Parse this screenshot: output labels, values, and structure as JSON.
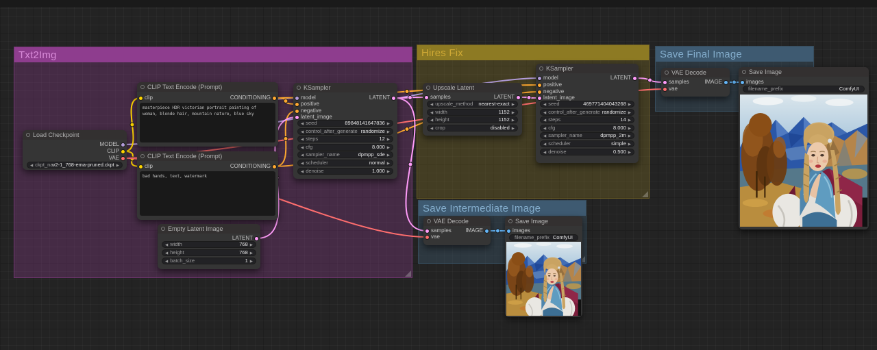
{
  "colors": {
    "MODEL": "#B39DDB",
    "CLIP": "#FFD500",
    "VAE": "#FF6E6E",
    "CONDITIONING": "#FFA931",
    "LATENT": "#FF9CF9",
    "IMAGE": "#64B5F6"
  },
  "groups": {
    "txt2img": {
      "title": "Txt2Img",
      "color": "#8e3d8e"
    },
    "hires_fix": {
      "title": "Hires Fix",
      "color": "#8d7a23"
    },
    "save_intermediate": {
      "title": "Save Intermediate Image",
      "color": "#3e5a71"
    },
    "save_final": {
      "title": "Save Final Image",
      "color": "#3e5a71"
    }
  },
  "nodes": {
    "load_checkpoint": {
      "title": "Load Checkpoint",
      "outputs": [
        "MODEL",
        "CLIP",
        "VAE"
      ],
      "widgets": [
        {
          "name": "ckpt_name",
          "value": "v2-1_768-ema-pruned.ckpt"
        }
      ]
    },
    "clip_positive": {
      "title": "CLIP Text Encode (Prompt)",
      "inputs": [
        "clip"
      ],
      "output": "CONDITIONING",
      "text": "masterpiece HDR victorian portrait painting of woman, blonde hair, mountain nature, blue sky"
    },
    "clip_negative": {
      "title": "CLIP Text Encode (Prompt)",
      "inputs": [
        "clip"
      ],
      "output": "CONDITIONING",
      "text": "bad hands, text, watermark"
    },
    "empty_latent": {
      "title": "Empty Latent Image",
      "output": "LATENT",
      "widgets": [
        {
          "name": "width",
          "value": "768"
        },
        {
          "name": "height",
          "value": "768"
        },
        {
          "name": "batch_size",
          "value": "1"
        }
      ]
    },
    "ksampler1": {
      "title": "KSampler",
      "inputs": [
        "model",
        "positive",
        "negative",
        "latent_image"
      ],
      "output": "LATENT",
      "widgets": [
        {
          "name": "seed",
          "value": "89848141647836"
        },
        {
          "name": "control_after_generate",
          "value": "randomize"
        },
        {
          "name": "steps",
          "value": "12"
        },
        {
          "name": "cfg",
          "value": "8.000"
        },
        {
          "name": "sampler_name",
          "value": "dpmpp_sde"
        },
        {
          "name": "scheduler",
          "value": "normal"
        },
        {
          "name": "denoise",
          "value": "1.000"
        }
      ]
    },
    "upscale_latent": {
      "title": "Upscale Latent",
      "inputs": [
        "samples"
      ],
      "output": "LATENT",
      "widgets": [
        {
          "name": "upscale_method",
          "value": "nearest-exact"
        },
        {
          "name": "width",
          "value": "1152"
        },
        {
          "name": "height",
          "value": "1152"
        },
        {
          "name": "crop",
          "value": "disabled"
        }
      ]
    },
    "ksampler2": {
      "title": "KSampler",
      "inputs": [
        "model",
        "positive",
        "negative",
        "latent_image"
      ],
      "output": "LATENT",
      "widgets": [
        {
          "name": "seed",
          "value": "469771404043268"
        },
        {
          "name": "control_after_generate",
          "value": "randomize"
        },
        {
          "name": "steps",
          "value": "14"
        },
        {
          "name": "cfg",
          "value": "8.000"
        },
        {
          "name": "sampler_name",
          "value": "dpmpp_2m"
        },
        {
          "name": "scheduler",
          "value": "simple"
        },
        {
          "name": "denoise",
          "value": "0.500"
        }
      ]
    },
    "vae_decode1": {
      "title": "VAE Decode",
      "inputs": [
        "samples",
        "vae"
      ],
      "output": "IMAGE"
    },
    "save_image1": {
      "title": "Save Image",
      "inputs": [
        "images"
      ],
      "widgets": [
        {
          "name": "filename_prefix",
          "value": "ComfyUI"
        }
      ]
    },
    "vae_decode2": {
      "title": "VAE Decode",
      "inputs": [
        "samples",
        "vae"
      ],
      "output": "IMAGE"
    },
    "save_image2": {
      "title": "Save Image",
      "inputs": [
        "images"
      ],
      "widgets": [
        {
          "name": "filename_prefix",
          "value": "ComfyUI"
        }
      ]
    }
  }
}
